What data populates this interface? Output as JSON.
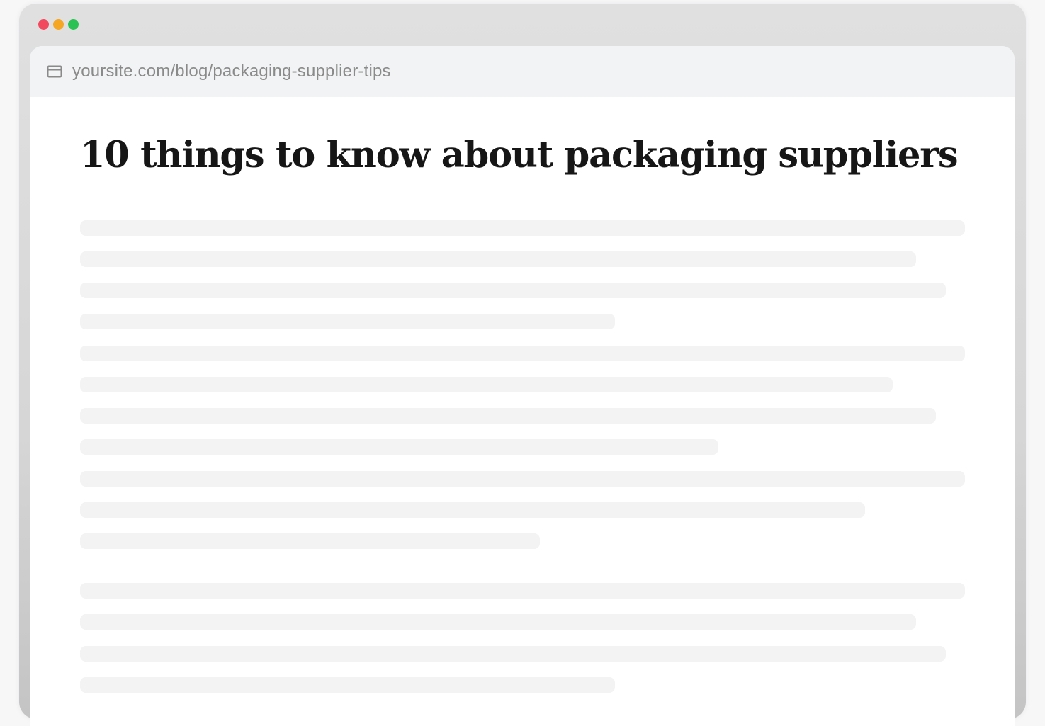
{
  "window": {
    "traffic_lights": [
      {
        "name": "close",
        "color": "#f2495e"
      },
      {
        "name": "minimize",
        "color": "#f5a623"
      },
      {
        "name": "maximize",
        "color": "#2bc255"
      }
    ]
  },
  "address_bar": {
    "icon": "browser-window-icon",
    "url": "yoursite.com/blog/packaging-supplier-tips"
  },
  "article": {
    "title": "10 things to know about packaging suppliers",
    "placeholder_color": "#f3f3f3"
  }
}
